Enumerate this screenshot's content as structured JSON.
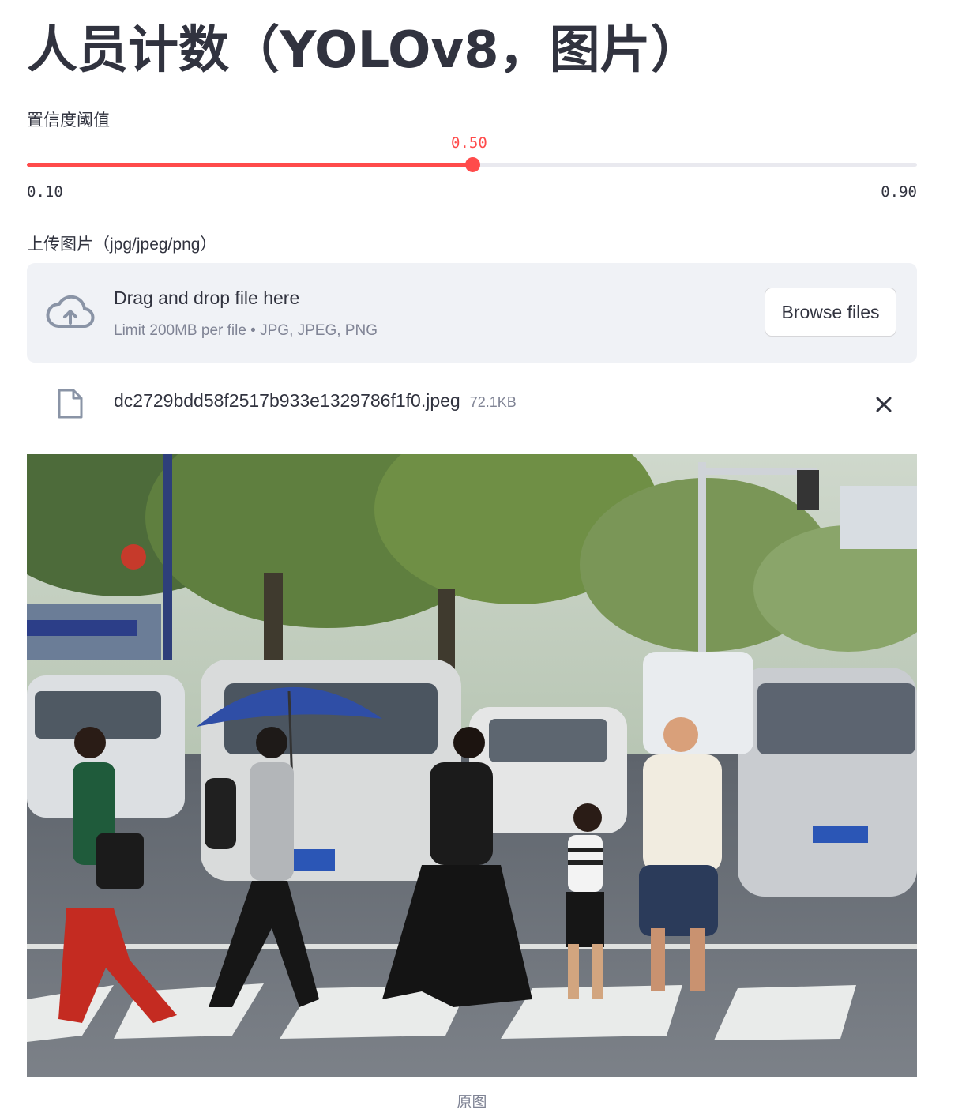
{
  "page": {
    "title": "人员计数（YOLOv8，图片）"
  },
  "slider": {
    "label": "置信度阈值",
    "value": "0.50",
    "value_num": 0.5,
    "min": "0.10",
    "max": "0.90",
    "min_num": 0.1,
    "max_num": 0.9,
    "accent_color": "#ff4b4b"
  },
  "uploader": {
    "label": "上传图片（jpg/jpeg/png）",
    "drop_title": "Drag and drop file here",
    "drop_limit": "Limit 200MB per file • JPG, JPEG, PNG",
    "browse_label": "Browse files",
    "icon": "cloud-upload-icon"
  },
  "file": {
    "name": "dc2729bdd58f2517b933e1329786f1f0.jpeg",
    "size": "72.1KB",
    "icon": "file-icon",
    "remove_icon": "close-icon"
  },
  "image": {
    "caption": "原图"
  }
}
